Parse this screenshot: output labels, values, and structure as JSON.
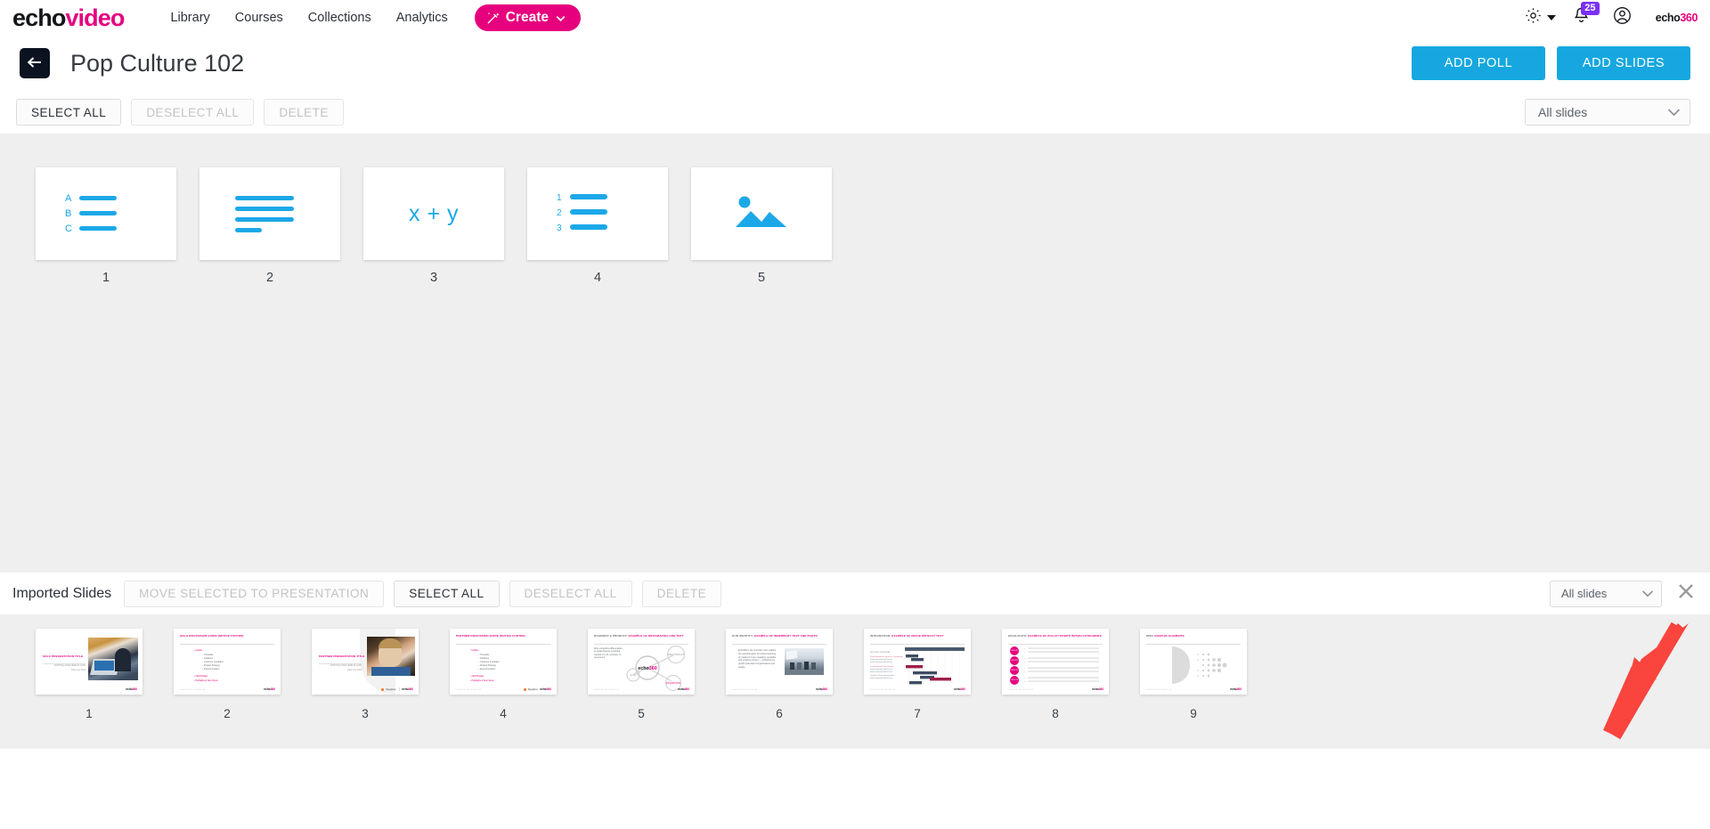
{
  "brand": {
    "logo_echo": "echo",
    "logo_video": "video",
    "accent_pink": "#e6007e",
    "accent_blue": "#16a7e0",
    "slide_icon_blue": "#1ca8e8",
    "badge_purple": "#7b2ff7",
    "annotation_red": "#f9453e"
  },
  "topnav": {
    "links": [
      {
        "label": "Library",
        "name": "nav-link-library"
      },
      {
        "label": "Courses",
        "name": "nav-link-courses"
      },
      {
        "label": "Collections",
        "name": "nav-link-collections"
      },
      {
        "label": "Analytics",
        "name": "nav-link-analytics"
      }
    ],
    "create_label": "Create",
    "notification_count": "25",
    "corner_logo_echo": "echo",
    "corner_logo_360": "360"
  },
  "titlebar": {
    "back_label": "",
    "title": "Pop Culture 102",
    "add_poll_label": "ADD POLL",
    "add_slides_label": "ADD SLIDES"
  },
  "toolbar": {
    "select_all_label": "SELECT ALL",
    "deselect_all_label": "DESELECT ALL",
    "delete_label": "DELETE",
    "filter_value": "All slides"
  },
  "presentation_slides": [
    {
      "number": "1",
      "kind": "multiple-choice-abc",
      "options": [
        "A",
        "B",
        "C"
      ]
    },
    {
      "number": "2",
      "kind": "free-text-lines"
    },
    {
      "number": "3",
      "kind": "numeric-formula",
      "formula": "x + y"
    },
    {
      "number": "4",
      "kind": "ordering-123",
      "options": [
        "1",
        "2",
        "3"
      ]
    },
    {
      "number": "5",
      "kind": "image-question"
    }
  ],
  "imported": {
    "section_label": "Imported Slides",
    "move_label": "MOVE SELECTED TO PRESENTATION",
    "select_all_label": "SELECT ALL",
    "deselect_all_label": "DESELECT ALL",
    "delete_label": "DELETE",
    "filter_value": "All slides",
    "close_label": "",
    "slides": [
      {
        "number": "1",
        "title": "SOLO PRESENTATION TITLE",
        "title_gray": "",
        "subtitle": "SUBTITLE GOES HERE IN CAPS",
        "date": "Date here 2023",
        "kind": "title-with-photo",
        "logo": "echo360"
      },
      {
        "number": "2",
        "title": "SOLO DISCUSSION GUIDE (NOTICE FOOTER)",
        "title_gray": "",
        "kind": "discussion-guide",
        "bullets": [
          "Update",
          "Timetable",
          "Initiatives",
          "Customer Feedback",
          "Product Strategy",
          "Experimentation",
          "2023 Budget",
          "Highlights & Next Steps"
        ],
        "footer": "CONFIDENTIAL AND INTERNAL USE"
      },
      {
        "number": "3",
        "title": "PARTNER PRESENTATION TITLE",
        "title_gray": "",
        "subtitle": "SUBTITLE GOES HERE IN CAPS",
        "date": "Date here 2023",
        "kind": "partner-title-with-photo",
        "logo": "Spyglass  echo360"
      },
      {
        "number": "4",
        "title": "PARTNER DISCUSSION GUIDE (NOTICE FOOTER)",
        "title_gray": "",
        "kind": "discussion-guide",
        "bullets": [
          "Update",
          "Timetable",
          "Initiatives",
          "Customer Feedback",
          "Product Strategy",
          "Experimentation",
          "2023 Budget",
          "Highlights & Next Steps"
        ],
        "footer": "CONFIDENTIAL AND INTERNAL USE"
      },
      {
        "number": "5",
        "title_gray": "ROADMAP & PRODUCT:",
        "title": "EXAMPLE OF INFOGRAPHIC AND TEXT",
        "kind": "infographic",
        "body": "Drive competitive differentiation as student/learner expanded markets in K-12, corporate, & government",
        "footer": "CONFIDENTIAL AND INTERNAL USE",
        "center_label": "echo360"
      },
      {
        "number": "6",
        "title_gray": "OUR IDENTITY:",
        "title": "EXAMPLE OF INNERBODY TEXT AND PHOTO",
        "kind": "text-and-photo",
        "body": "Echo360 is the innovator who enables the transformation of inspired learning by making it more engaging, equitable and evidence-driven — unlocking the growth potential of organizations and people.",
        "footer": "CONFIDENTIAL AND INTERNAL USE"
      },
      {
        "number": "7",
        "title_gray": "INTEGRATION:",
        "title": "EXAMPLE OF IMAGE WITHOUT TEXT",
        "kind": "gantt-chart",
        "footer": "CONFIDENTIAL AND INTERNAL USE"
      },
      {
        "number": "8",
        "title_gray": "HIGHLIGHTS:",
        "title": "EXAMPLE OF BULLET POINTS WITHIN CATEGORIES",
        "kind": "bullet-categories",
        "footer": "CONFIDENTIAL AND INTERNAL USE"
      },
      {
        "number": "9",
        "title_gray": "MISC",
        "title": "GRAPHIC ELEMENTS",
        "kind": "misc-graphics",
        "footer": "CONFIDENTIAL AND INTERNAL USE"
      }
    ]
  }
}
